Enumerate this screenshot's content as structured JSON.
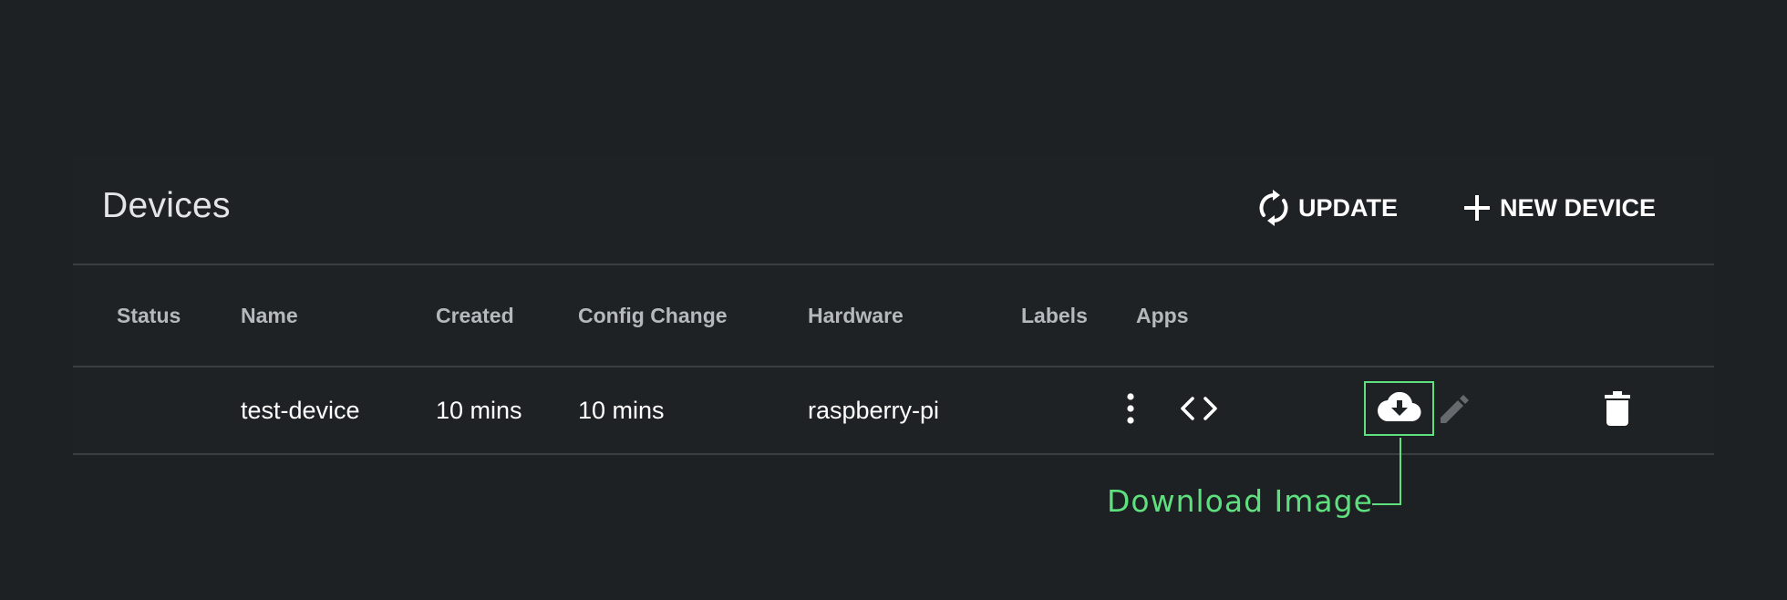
{
  "header": {
    "title": "Devices",
    "update_label": "UPDATE",
    "new_device_label": "NEW DEVICE"
  },
  "table": {
    "columns": [
      "Status",
      "Name",
      "Created",
      "Config Change",
      "Hardware",
      "Labels",
      "Apps"
    ],
    "rows": [
      {
        "status": "",
        "name": "test-device",
        "created": "10 mins",
        "config_change": "10 mins",
        "hardware": "raspberry-pi",
        "labels_icon": "more-vertical-icon",
        "apps_icon": "code-icon",
        "actions": [
          "cloud-download-icon",
          "edit-pencil-icon",
          "trash-icon"
        ]
      }
    ]
  },
  "callout": {
    "label": "Download Image"
  },
  "colors": {
    "background": "#1e2124",
    "divider": "#3a3e42",
    "highlight": "#5fe07e",
    "header_text": "#b5b9bd"
  }
}
